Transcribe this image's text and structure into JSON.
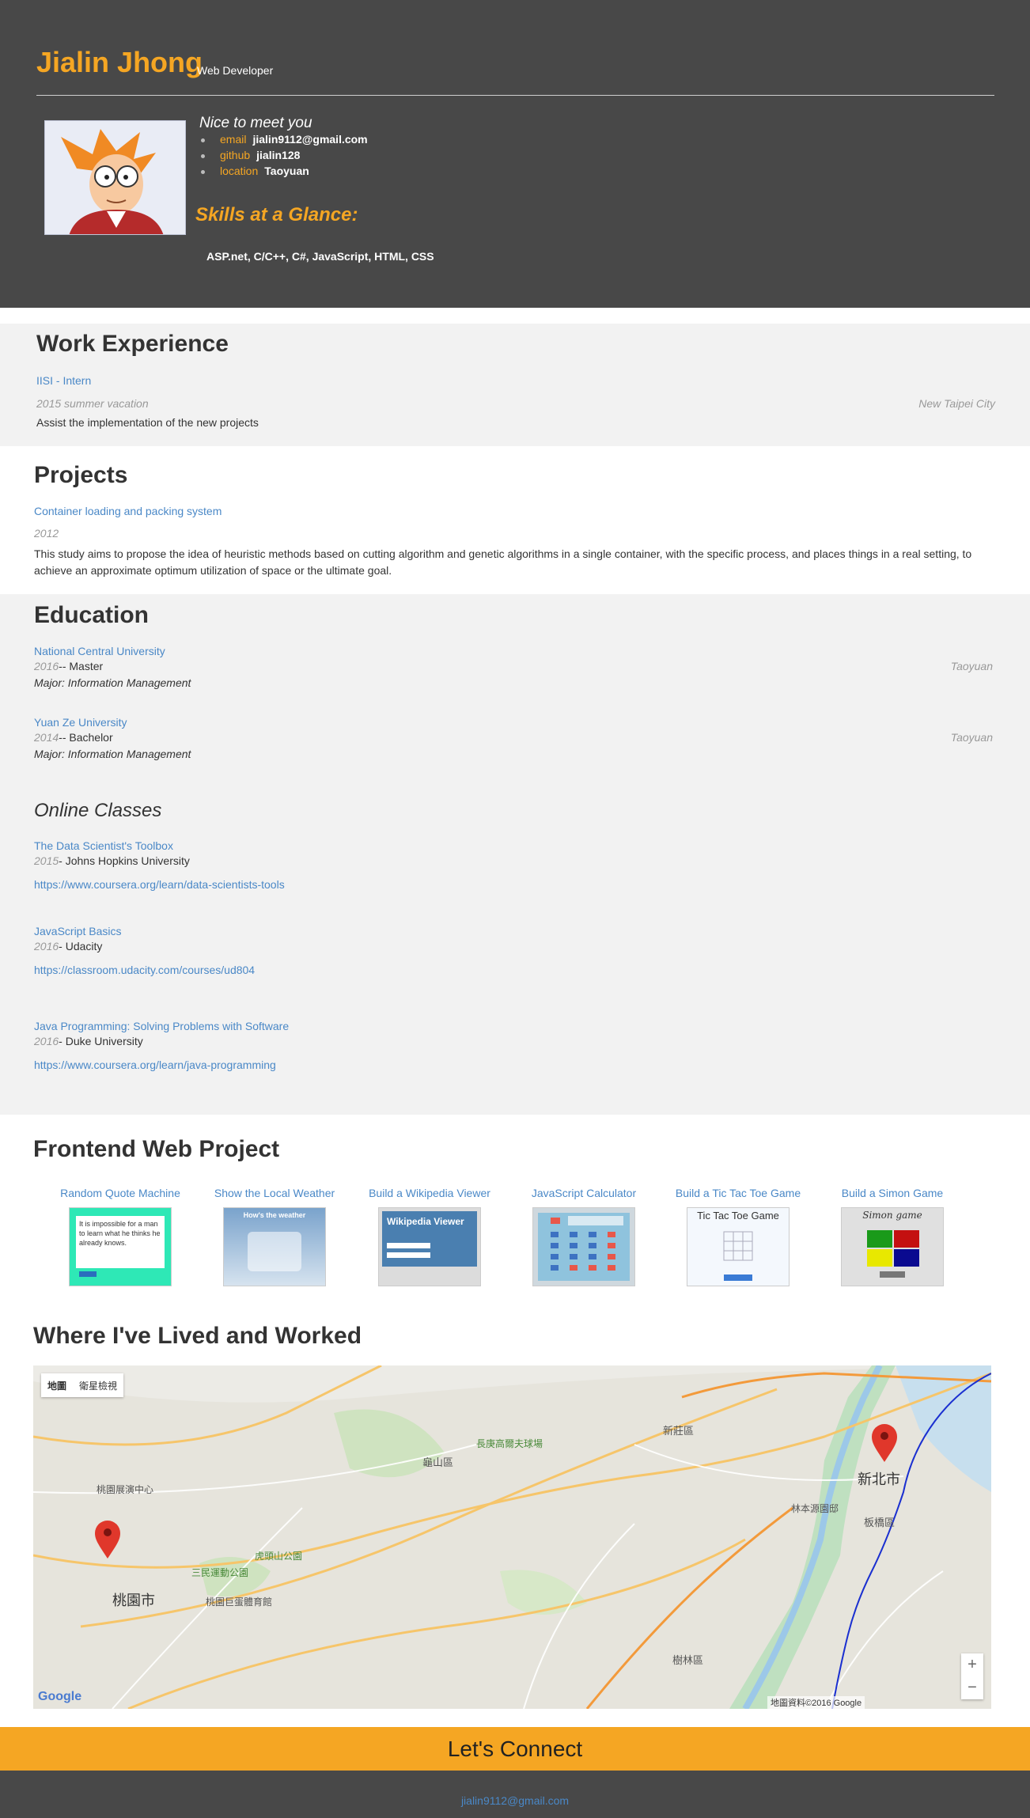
{
  "header": {
    "name": "Jialin Jhong",
    "role": "Web Developer",
    "greeting": "Nice to meet you",
    "contacts": [
      {
        "key": "email",
        "value": "jialin9112@gmail.com"
      },
      {
        "key": "github",
        "value": "jialin128"
      },
      {
        "key": "location",
        "value": "Taoyuan"
      }
    ],
    "skills_title": "Skills at a Glance:",
    "skills": "ASP.net, C/C++, C#, JavaScript, HTML, CSS"
  },
  "work": {
    "heading": "Work Experience",
    "items": [
      {
        "title": "IISI - Intern",
        "date": "2015 summer vacation",
        "location": "New Taipei City",
        "description": "Assist the implementation of the new projects"
      }
    ]
  },
  "projects": {
    "heading": "Projects",
    "items": [
      {
        "title": "Container loading and packing system",
        "date": "2012",
        "description": "This study aims to propose the idea of heuristic methods based on cutting algorithm and genetic algorithms in a single container, with the specific process, and places things in a real setting, to achieve an approximate optimum utilization of space or the ultimate goal."
      }
    ]
  },
  "education": {
    "heading": "Education",
    "schools": [
      {
        "name": "National Central University",
        "year": "2016",
        "degree": "-- Master",
        "location": "Taoyuan",
        "major": "Major: Information Management"
      },
      {
        "name": "Yuan Ze University",
        "year": "2014",
        "degree": "-- Bachelor",
        "location": "Taoyuan",
        "major": "Major: Information Management"
      }
    ],
    "online_heading": "Online Classes",
    "classes": [
      {
        "title": "The Data Scientist's Toolbox",
        "year": "2015",
        "school": "- Johns Hopkins University",
        "url": "https://www.coursera.org/learn/data-scientists-tools"
      },
      {
        "title": "JavaScript Basics",
        "year": "2016",
        "school": "- Udacity",
        "url": "https://classroom.udacity.com/courses/ud804"
      },
      {
        "title": "Java Programming: Solving Problems with Software",
        "year": "2016",
        "school": "- Duke University",
        "url": "https://www.coursera.org/learn/java-programming"
      }
    ]
  },
  "frontend": {
    "heading": "Frontend Web Project",
    "items": [
      {
        "title": "Random Quote Machine",
        "thumb_text": "It is impossible for a man to learn what he thinks he already knows."
      },
      {
        "title": "Show the Local Weather",
        "thumb_text": "How's the weather"
      },
      {
        "title": "Build a Wikipedia Viewer",
        "thumb_text": "Wikipedia Viewer"
      },
      {
        "title": "JavaScript Calculator",
        "thumb_text": ""
      },
      {
        "title": "Build a Tic Tac Toe Game",
        "thumb_text": "Tic Tac Toe Game"
      },
      {
        "title": "Build a Simon Game",
        "thumb_text": "Simon game"
      }
    ]
  },
  "map": {
    "heading": "Where I've Lived and Worked",
    "map_tab": "地圖",
    "satellite_tab": "衛星檢視",
    "labels": [
      "桃園市",
      "新北市",
      "龜山區",
      "桃園展演中心",
      "長庚高爾夫球場",
      "林本源園邸",
      "虎頭山公園",
      "三民運動公園",
      "桃園巨蛋體育館",
      "樹林區",
      "新莊區",
      "板橋區"
    ],
    "google": "Google",
    "attribution": "地圖資料©2016 Google",
    "zoom_in": "+",
    "zoom_out": "−"
  },
  "connect": {
    "heading": "Let's Connect",
    "email": "jialin9112@gmail.com"
  },
  "colors": {
    "accent": "#f5a623",
    "link": "#4a88c7",
    "header_bg": "#484848",
    "section_bg": "#f2f2f2"
  }
}
